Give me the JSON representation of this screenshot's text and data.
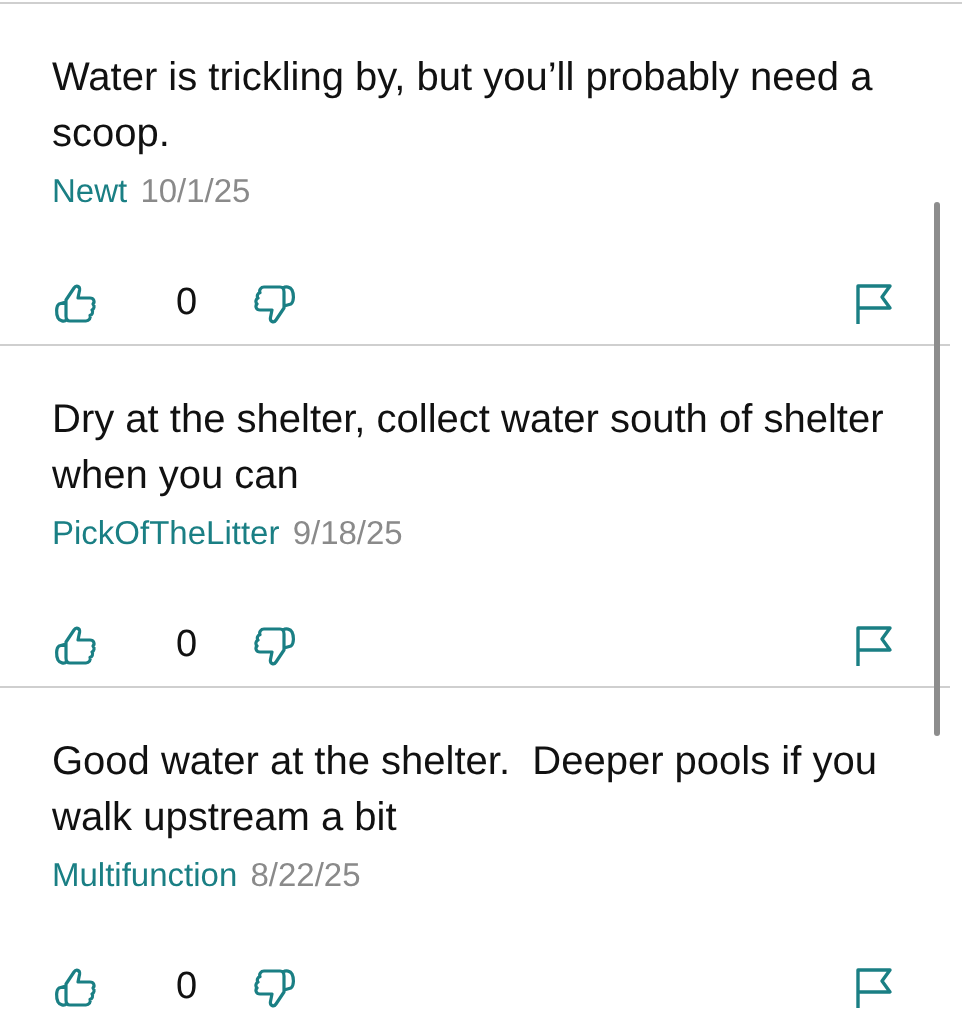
{
  "comments": [
    {
      "text": "Water is trickling by, but you’ll probably need a scoop.",
      "author": "Newt",
      "date": "10/1/25",
      "votes": "0"
    },
    {
      "text": "Dry at the shelter, collect water south of shelter when you can",
      "author": "PickOfTheLitter",
      "date": "9/18/25",
      "votes": "0"
    },
    {
      "text": "Good water at the shelter.  Deeper pools if you walk upstream a bit",
      "author": "Multifunction",
      "date": "8/22/25",
      "votes": "0"
    }
  ]
}
